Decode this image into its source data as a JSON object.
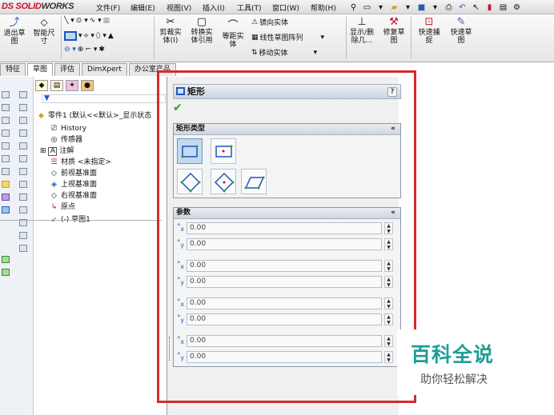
{
  "app": {
    "logo_prefix": "DS",
    "logo_main": "SOLID",
    "logo_rest": "WORKS"
  },
  "menubar": [
    "文件(F)",
    "编辑(E)",
    "视图(V)",
    "插入(I)",
    "工具(T)",
    "窗口(W)",
    "帮助(H)"
  ],
  "toolbar": {
    "exit_sketch": "退出草\n图",
    "smart_dimension": "智能尺\n寸",
    "trim": "剪裁实\n体(I)",
    "convert": "转换实\n体引用",
    "offset": "等距实\n体",
    "mirror": "镜向实体",
    "linear_pattern": "线性草图阵列",
    "move": "移动实体",
    "display_delete": "显示/删\n除几...",
    "repair": "修复草\n图",
    "quick_snap": "快速捕\n捉",
    "rapid_sketch": "快速草\n图"
  },
  "tabs": [
    "特征",
    "草图",
    "评估",
    "DimXpert",
    "办公室产品"
  ],
  "tree": {
    "root": "零件1 (默认<<默认>_显示状态",
    "items": [
      "History",
      "传感器",
      "注解",
      "材质 <未指定>",
      "前视基准面",
      "上视基准面",
      "右视基准面",
      "原点",
      "(-) 草图1"
    ]
  },
  "property_manager": {
    "title": "矩形",
    "help": "?",
    "ok": "✔",
    "rect_type_label": "矩形类型",
    "params_label": "参数",
    "chevron": "«",
    "params": [
      {
        "axis": "x",
        "value": "0.00"
      },
      {
        "axis": "y",
        "value": "0.00"
      },
      {
        "axis": "x",
        "value": "0.00"
      },
      {
        "axis": "y",
        "value": "0.00"
      },
      {
        "axis": "x",
        "value": "0.00"
      },
      {
        "axis": "y",
        "value": "0.00"
      },
      {
        "axis": "x",
        "value": "0.00"
      },
      {
        "axis": "y",
        "value": "0.00"
      }
    ]
  },
  "watermark": {
    "title": "百科全说",
    "subtitle": "助你轻松解决"
  },
  "colors": {
    "highlight": "#d62b2b",
    "watermark": "#1e9e96",
    "selection": "#c4d9ee"
  }
}
